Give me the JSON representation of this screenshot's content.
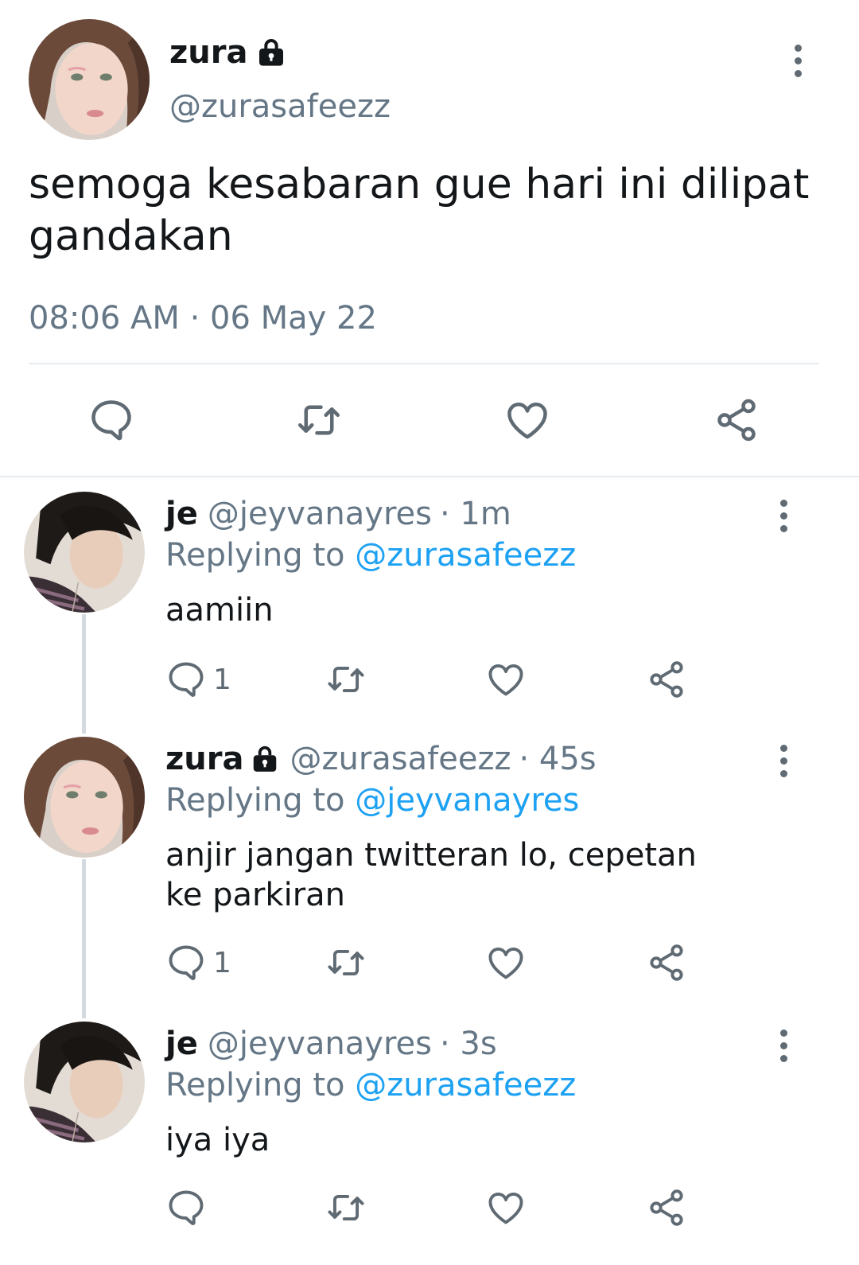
{
  "main_tweet": {
    "name": "zura",
    "handle": "@zurasafeezz",
    "text": "semoga kesabaran gue hari ini dilipat gandakan",
    "timestamp": "08:06 AM · 06 May 22",
    "icons": [
      "lock-icon",
      "more-options-icon",
      "reply-icon",
      "retweet-icon",
      "like-icon",
      "share-icon"
    ]
  },
  "replies": [
    {
      "name": "je",
      "handle": "@jeyvanayres",
      "time": "· 1m",
      "replying_prefix": "Replying to ",
      "replying_to": "@zurasafeezz",
      "text": "aamiin",
      "reply_count": "1"
    },
    {
      "name": "zura",
      "handle": "@zurasafeezz",
      "time": "· 45s",
      "replying_prefix": "Replying to ",
      "replying_to": "@jeyvanayres",
      "text": "anjir jangan twitteran lo, cepetan ke parkiran",
      "reply_count": "1"
    },
    {
      "name": "je",
      "handle": "@jeyvanayres",
      "time": "· 3s",
      "replying_prefix": "Replying to ",
      "replying_to": "@zurasafeezz",
      "text": "iya iya",
      "reply_count": ""
    }
  ],
  "colors": {
    "text": "#14171a",
    "secondary": "#657786",
    "link": "#1da1f2",
    "divider": "#e6ecf0",
    "icon": "#5f6a73"
  }
}
